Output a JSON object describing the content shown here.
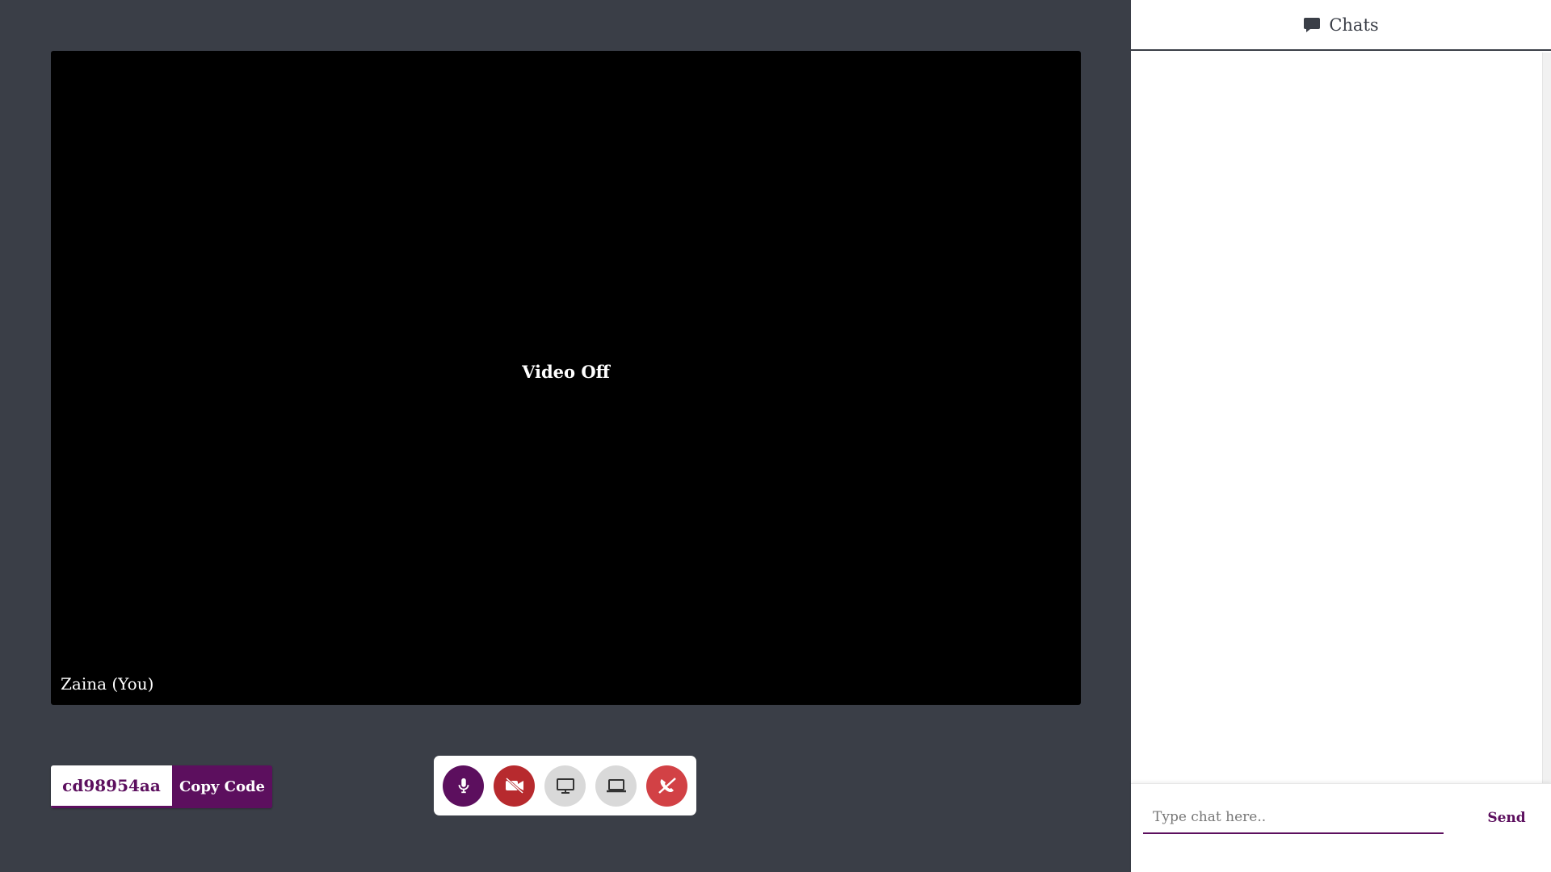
{
  "video": {
    "status_text": "Video Off",
    "participant_name": "Zaina (You)"
  },
  "meeting": {
    "code": "cd98954aa",
    "copy_label": "Copy Code"
  },
  "controls": [
    {
      "icon": "microphone-icon",
      "state": "on",
      "color": "#5c0f5e"
    },
    {
      "icon": "video-off-icon",
      "state": "off",
      "color": "#b72a2e"
    },
    {
      "icon": "desktop-icon",
      "state": "idle",
      "color": "#d9d9d9"
    },
    {
      "icon": "laptop-icon",
      "state": "idle",
      "color": "#d9d9d9"
    },
    {
      "icon": "end-call-icon",
      "state": "danger",
      "color": "#d24145"
    }
  ],
  "chat": {
    "title": "Chats",
    "title_icon": "chat-bubble-icon",
    "messages": [],
    "input_placeholder": "Type chat here..",
    "input_value": "",
    "send_label": "Send"
  },
  "colors": {
    "stage_background": "#3a3e47",
    "brand": "#5c0f5e",
    "danger": "#b72a2e"
  }
}
